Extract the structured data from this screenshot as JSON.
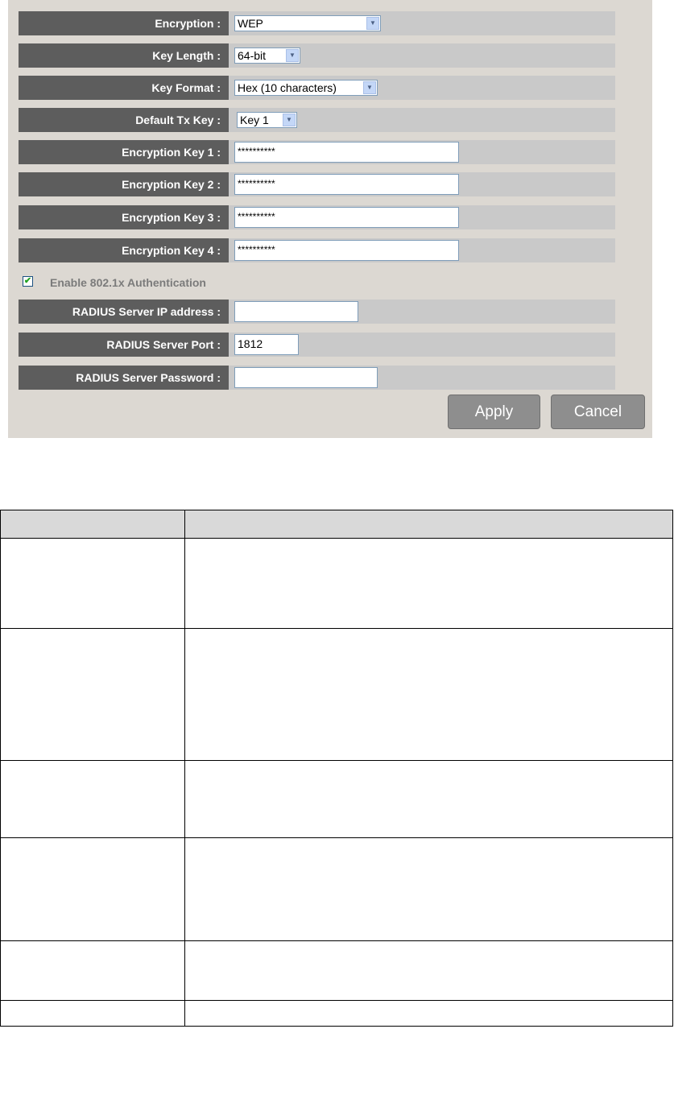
{
  "form": {
    "encryption": {
      "label": "Encryption :",
      "value": "WEP"
    },
    "key_length": {
      "label": "Key Length :",
      "value": "64-bit"
    },
    "key_format": {
      "label": "Key Format :",
      "value": "Hex (10 characters)"
    },
    "default_tx_key": {
      "label": "Default Tx Key :",
      "value": "Key 1"
    },
    "encryption_key_1": {
      "label": "Encryption Key 1 :",
      "value": "**********"
    },
    "encryption_key_2": {
      "label": "Encryption Key 2 :",
      "value": "**********"
    },
    "encryption_key_3": {
      "label": "Encryption Key 3 :",
      "value": "**********"
    },
    "encryption_key_4": {
      "label": "Encryption Key 4 :",
      "value": "**********"
    },
    "enable_8021x": {
      "label": "Enable 802.1x Authentication",
      "checked": true
    },
    "radius_ip": {
      "label": "RADIUS Server IP address :",
      "value": ""
    },
    "radius_port": {
      "label": "RADIUS Server Port :",
      "value": "1812"
    },
    "radius_password": {
      "label": "RADIUS Server Password :",
      "value": ""
    },
    "apply_label": "Apply",
    "cancel_label": "Cancel"
  },
  "icons": {
    "dropdown": "chevron-down-icon",
    "checkbox": "checkmark-icon"
  },
  "colors": {
    "panel_bg": "#dcd8d2",
    "label_bg": "#5d5d5d",
    "strip_bg": "#c9c9c9",
    "button_bg": "#8e8e8e",
    "checkmark": "#21a121"
  },
  "desc_table": {
    "header": [
      "",
      ""
    ],
    "rows": [
      [
        "",
        ""
      ],
      [
        "",
        ""
      ],
      [
        "",
        ""
      ],
      [
        "",
        ""
      ],
      [
        "",
        ""
      ],
      [
        "",
        ""
      ]
    ]
  }
}
